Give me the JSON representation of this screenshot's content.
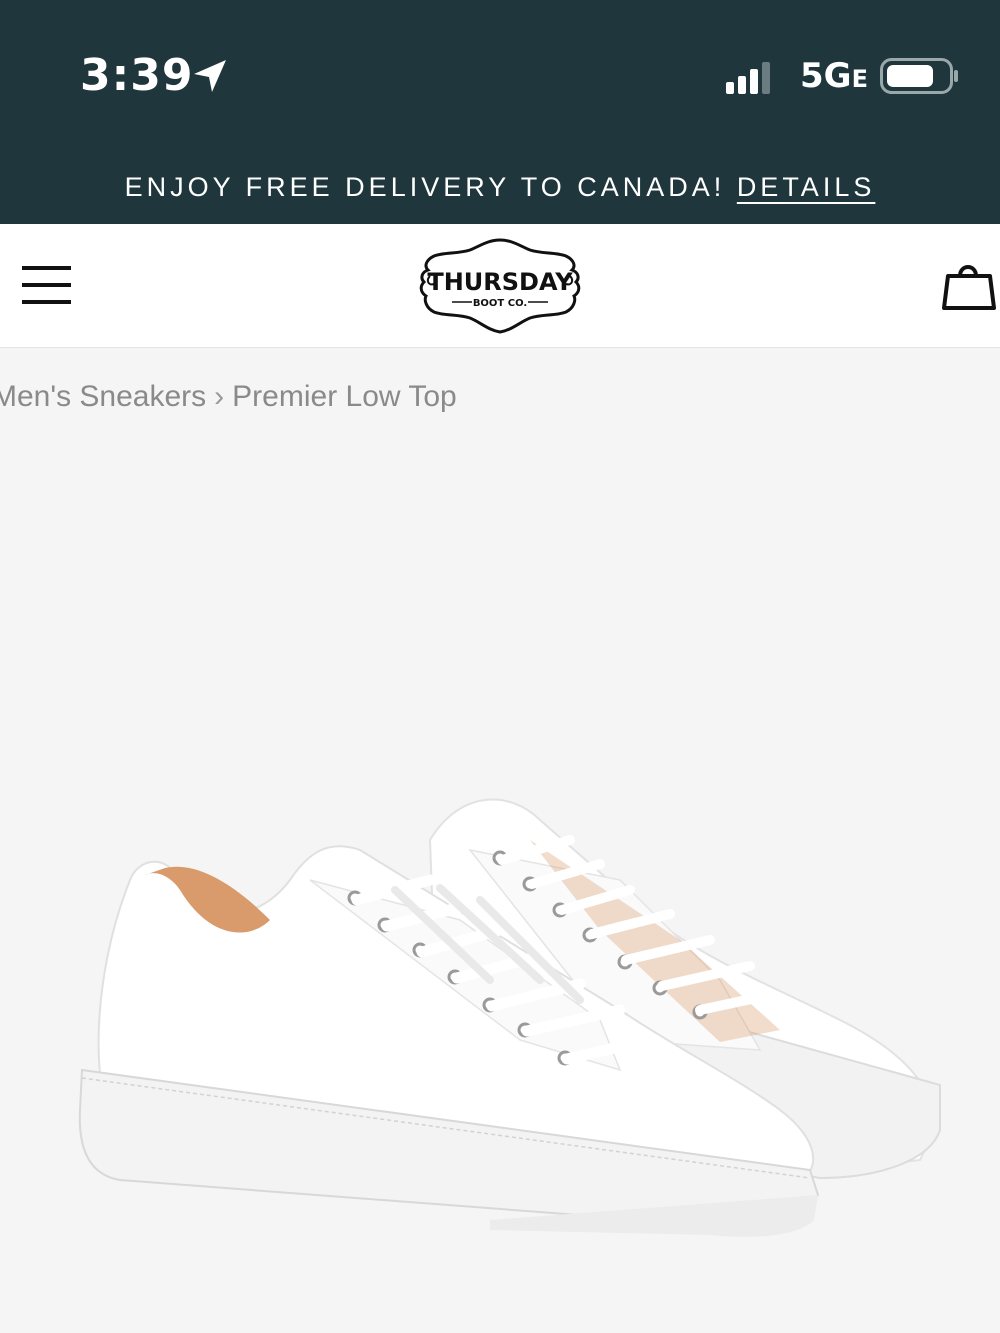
{
  "status_bar": {
    "time": "3:39",
    "network": "5G",
    "network_suffix": "E",
    "icons": [
      "location-arrow-icon",
      "signal-bars-icon",
      "battery-icon"
    ]
  },
  "banner": {
    "text": "ENJOY FREE DELIVERY TO CANADA! ",
    "link": "DETAILS"
  },
  "header": {
    "logo_main": "THURSDAY",
    "logo_sub": "BOOT CO.",
    "icons": [
      "hamburger-menu-icon",
      "shopping-bag-icon"
    ]
  },
  "breadcrumb": {
    "items": [
      "Men's Sneakers",
      "Premier Low Top"
    ],
    "separator": "›"
  },
  "product": {
    "image": "white-low-top-sneakers-pair"
  },
  "colors": {
    "header_bg": "#1f373c",
    "page_bg": "#f5f5f5",
    "lining": "#d99a6c"
  }
}
